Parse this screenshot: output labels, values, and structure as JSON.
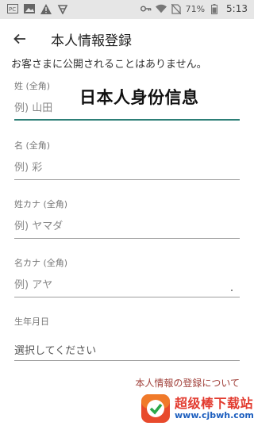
{
  "status_bar": {
    "battery": "71%",
    "time": "5:13",
    "left_icons": [
      "pc-icon",
      "image-icon",
      "warning-icon",
      "share-icon"
    ],
    "right_icons": [
      "key-icon",
      "wifi-icon",
      "no-sim-icon",
      "battery-icon"
    ]
  },
  "app_bar": {
    "title": "本人情報登録"
  },
  "notice": "お客さまに公開されることはありません。",
  "overlay_caption": "日本人身份信息",
  "form": {
    "last_name": {
      "label": "姓 (全角)",
      "placeholder": "例) 山田"
    },
    "first_name": {
      "label": "名 (全角)",
      "placeholder": "例) 彩"
    },
    "last_name_kana": {
      "label": "姓カナ (全角)",
      "placeholder": "例) ヤマダ"
    },
    "first_name_kana": {
      "label": "名カナ (全角)",
      "placeholder": "例) アヤ"
    },
    "birthdate": {
      "label": "生年月日",
      "value": "選択してください"
    }
  },
  "info_link": {
    "prefix": "本人情報",
    "middle": "の登録",
    "suffix": "について"
  },
  "watermark": {
    "main": "超级棒下载站",
    "url": "www.cjbwh.com"
  },
  "colors": {
    "accent": "#2d7f77",
    "link": "#a0403a",
    "status_bar_bg": "#e6e6e6"
  }
}
